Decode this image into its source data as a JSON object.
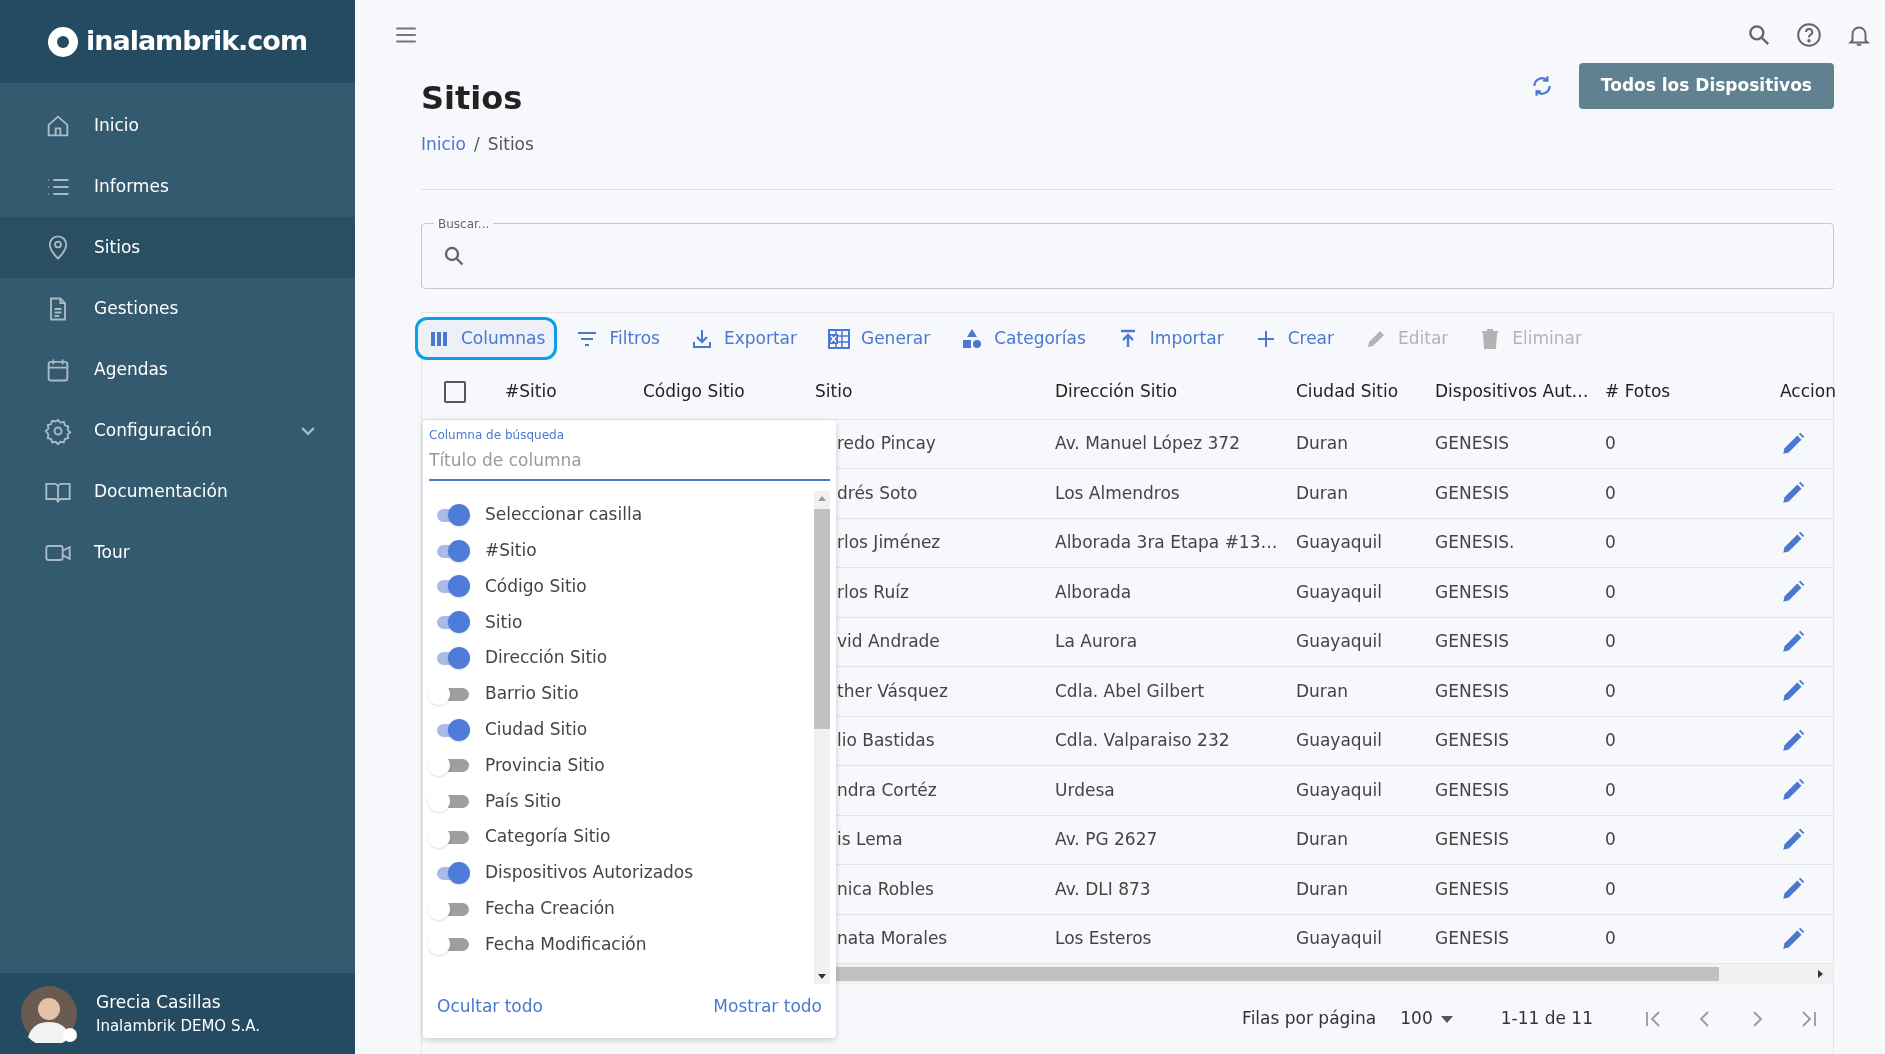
{
  "sidebar": {
    "logo": "inalambrik.com",
    "items": [
      {
        "label": "Inicio",
        "selected": false,
        "kind": "link"
      },
      {
        "label": "Informes",
        "selected": false,
        "kind": "link"
      },
      {
        "label": "Sitios",
        "selected": true,
        "kind": "link"
      },
      {
        "label": "Gestiones",
        "selected": false,
        "kind": "link"
      },
      {
        "label": "Agendas",
        "selected": false,
        "kind": "link"
      },
      {
        "label": "Configuración",
        "selected": false,
        "kind": "group"
      },
      {
        "label": "Documentación",
        "selected": false,
        "kind": "link"
      },
      {
        "label": "Tour",
        "selected": false,
        "kind": "link"
      }
    ],
    "user": {
      "name": "Grecia Casillas",
      "company": "Inalambrik DEMO S.A."
    }
  },
  "page": {
    "title": "Sitios",
    "breadcrumb": [
      {
        "label": "Inicio",
        "link": true
      },
      {
        "label": "Sitios",
        "link": false
      }
    ],
    "breadcrumb_separator": "/",
    "primary_button": "Todos los Dispositivos"
  },
  "search": {
    "label": "Buscar..."
  },
  "toolbar": [
    {
      "label": "Columnas",
      "selected": true,
      "disabled": false
    },
    {
      "label": "Filtros",
      "selected": false,
      "disabled": false
    },
    {
      "label": "Exportar",
      "selected": false,
      "disabled": false
    },
    {
      "label": "Generar",
      "selected": false,
      "disabled": false
    },
    {
      "label": "Categorías",
      "selected": false,
      "disabled": false
    },
    {
      "label": "Importar",
      "selected": false,
      "disabled": false
    },
    {
      "label": "Crear",
      "selected": false,
      "disabled": false
    },
    {
      "label": "Editar",
      "selected": false,
      "disabled": true
    },
    {
      "label": "Eliminar",
      "selected": false,
      "disabled": true
    }
  ],
  "table": {
    "select_all": {
      "checked": false
    },
    "columns": [
      "#Sitio",
      "Código Sitio",
      "Sitio",
      "Dirección Sitio",
      "Ciudad Sitio",
      "Dispositivos Aut…",
      "# Fotos",
      "Accion"
    ],
    "rows": [
      {
        "sitio": "redo Pincay",
        "direccion": "Av. Manuel López 372",
        "ciudad": "Duran",
        "dispositivos": "GENESIS",
        "fotos": "0"
      },
      {
        "sitio": "drés Soto",
        "direccion": "Los Almendros",
        "ciudad": "Duran",
        "dispositivos": "GENESIS",
        "fotos": "0"
      },
      {
        "sitio": "rlos Jiménez",
        "direccion": "Alborada 3ra Etapa #13…",
        "ciudad": "Guayaquil",
        "dispositivos": "GENESIS.",
        "fotos": "0"
      },
      {
        "sitio": "rlos Ruíz",
        "direccion": "Alborada",
        "ciudad": "Guayaquil",
        "dispositivos": "GENESIS",
        "fotos": "0"
      },
      {
        "sitio": "vid Andrade",
        "direccion": "La Aurora",
        "ciudad": "Guayaquil",
        "dispositivos": "GENESIS",
        "fotos": "0"
      },
      {
        "sitio": "ther Vásquez",
        "direccion": "Cdla. Abel Gilbert",
        "ciudad": "Duran",
        "dispositivos": "GENESIS",
        "fotos": "0"
      },
      {
        "sitio": "lio Bastidas",
        "direccion": "Cdla. Valparaiso 232",
        "ciudad": "Guayaquil",
        "dispositivos": "GENESIS",
        "fotos": "0"
      },
      {
        "sitio": "ndra Cortéz",
        "direccion": "Urdesa",
        "ciudad": "Guayaquil",
        "dispositivos": "GENESIS",
        "fotos": "0"
      },
      {
        "sitio": "is Lema",
        "direccion": "Av. PG 2627",
        "ciudad": "Duran",
        "dispositivos": "GENESIS",
        "fotos": "0"
      },
      {
        "sitio": "nica Robles",
        "direccion": "Av. DLI 873",
        "ciudad": "Duran",
        "dispositivos": "GENESIS",
        "fotos": "0"
      },
      {
        "sitio": "nata Morales",
        "direccion": "Los Esteros",
        "ciudad": "Guayaquil",
        "dispositivos": "GENESIS",
        "fotos": "0"
      }
    ]
  },
  "columns_panel": {
    "search_label": "Columna de búsqueda",
    "placeholder": "Título de columna",
    "options": [
      {
        "label": "Seleccionar casilla",
        "checked": true
      },
      {
        "label": "#Sitio",
        "checked": true
      },
      {
        "label": "Código Sitio",
        "checked": true
      },
      {
        "label": "Sitio",
        "checked": true
      },
      {
        "label": "Dirección Sitio",
        "checked": true
      },
      {
        "label": "Barrio Sitio",
        "checked": false
      },
      {
        "label": "Ciudad Sitio",
        "checked": true
      },
      {
        "label": "Provincia Sitio",
        "checked": false
      },
      {
        "label": "País Sitio",
        "checked": false
      },
      {
        "label": "Categoría Sitio",
        "checked": false
      },
      {
        "label": "Dispositivos Autorizados",
        "checked": true
      },
      {
        "label": "Fecha Creación",
        "checked": false
      },
      {
        "label": "Fecha Modificación",
        "checked": false
      }
    ],
    "hide_all": "Ocultar todo",
    "show_all": "Mostrar todo"
  },
  "pagination": {
    "rows_label": "Filas por página",
    "rows_value": "100",
    "range": "1-11 de 11"
  }
}
